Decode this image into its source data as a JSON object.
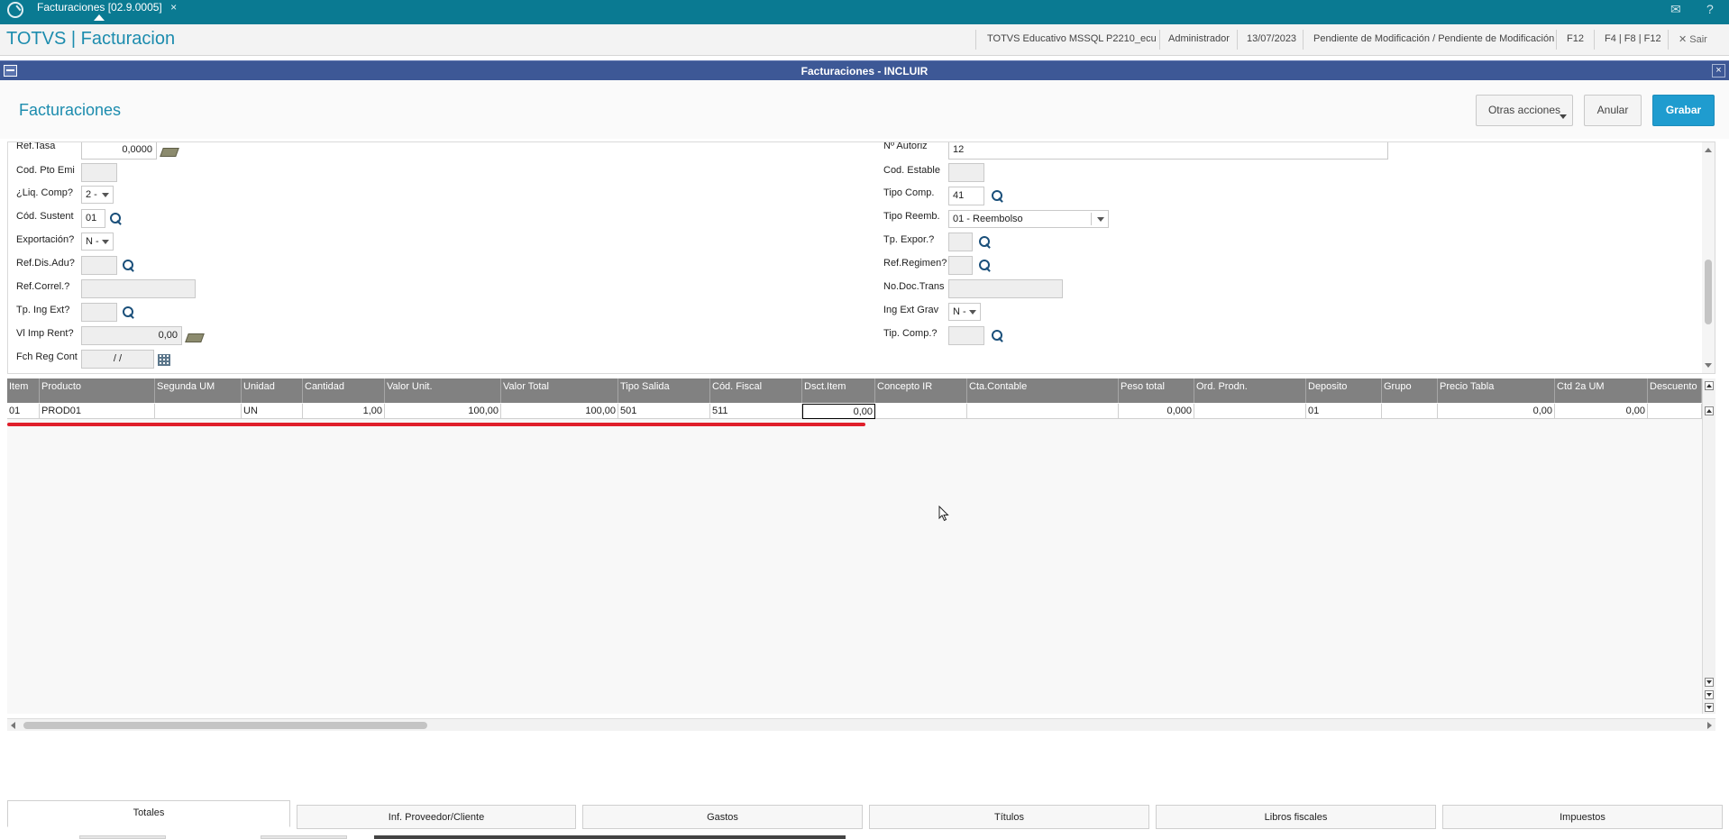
{
  "topbar": {
    "tab_label": "Facturaciones [02.9.0005]",
    "tab_close": "×",
    "mail_icon": "mail-icon",
    "help_icon": "help-icon"
  },
  "header": {
    "app_title": "TOTVS | Facturacion",
    "environment": "TOTVS Educativo MSSQL P2210_ecu",
    "user": "Administrador",
    "date": "13/07/2023",
    "status": "Pendiente de Modificación / Pendiente de Modificación",
    "f12": "F12",
    "shortcuts": "F4 | F8 | F12",
    "exit": "Sair"
  },
  "window": {
    "title": "Facturaciones - INCLUIR",
    "close": "×"
  },
  "form": {
    "title": "Facturaciones",
    "more_actions": "Otras acciones",
    "cancel": "Anular",
    "save": "Grabar"
  },
  "fields": {
    "ref_tasa_label": "Ref.Tasa",
    "ref_tasa_value": "0,0000",
    "cod_pto_emi_label": "Cod. Pto Emi",
    "liq_comp_label": "¿Liq. Comp?",
    "liq_comp_value": "2 -",
    "cod_sustent_label": "Cód. Sustent",
    "cod_sustent_value": "01",
    "exportacion_label": "Exportación?",
    "exportacion_value": "N -",
    "ref_dis_adu_label": "Ref.Dis.Adu?",
    "ref_correl_label": "Ref.Correl.?",
    "tp_ing_ext_label": "Tp. Ing Ext?",
    "vl_imp_rent_label": "Vl Imp Rent?",
    "vl_imp_rent_value": "0,00",
    "fch_reg_cont_label": "Fch Reg Cont",
    "fch_reg_cont_value": "/  /",
    "n_autoriz_label": "Nº Autoriz",
    "n_autoriz_value": "12",
    "cod_estable_label": "Cod. Estable",
    "tipo_comp_label": "Tipo Comp.",
    "tipo_comp_value": "41",
    "tipo_reemb_label": "Tipo Reemb.",
    "tipo_reemb_value": "01 - Reembolso",
    "tp_expor_label": "Tp. Expor.?",
    "ref_regimen_label": "Ref.Regimen?",
    "no_doc_trans_label": "No.Doc.Trans",
    "ing_ext_grav_label": "Ing Ext Grav",
    "ing_ext_grav_value": "N -",
    "tip_comp_label": "Tip. Comp.?"
  },
  "grid": {
    "columns": [
      "Item",
      "Producto",
      "Segunda UM",
      "Unidad",
      "Cantidad",
      "Valor Unit.",
      "Valor Total",
      "Tipo Salida",
      "Cód. Fiscal",
      "Dsct.Item",
      "Concepto IR",
      "Cta.Contable",
      "Peso total",
      "Ord. Prodn.",
      "Deposito",
      "Grupo",
      "Precio Tabla",
      "Ctd 2a UM",
      "Descuento"
    ],
    "rows": [
      [
        "01",
        "PROD01",
        "",
        "UN",
        "1,00",
        "100,00",
        "100,00",
        "501",
        "511",
        "0,00",
        "",
        "",
        "0,000",
        "",
        "01",
        "",
        "0,00",
        "0,00",
        ""
      ]
    ]
  },
  "bottom_tabs": [
    "Totales",
    "Inf. Proveedor/Cliente",
    "Gastos",
    "Títulos",
    "Libros fiscales",
    "Impuestos"
  ]
}
